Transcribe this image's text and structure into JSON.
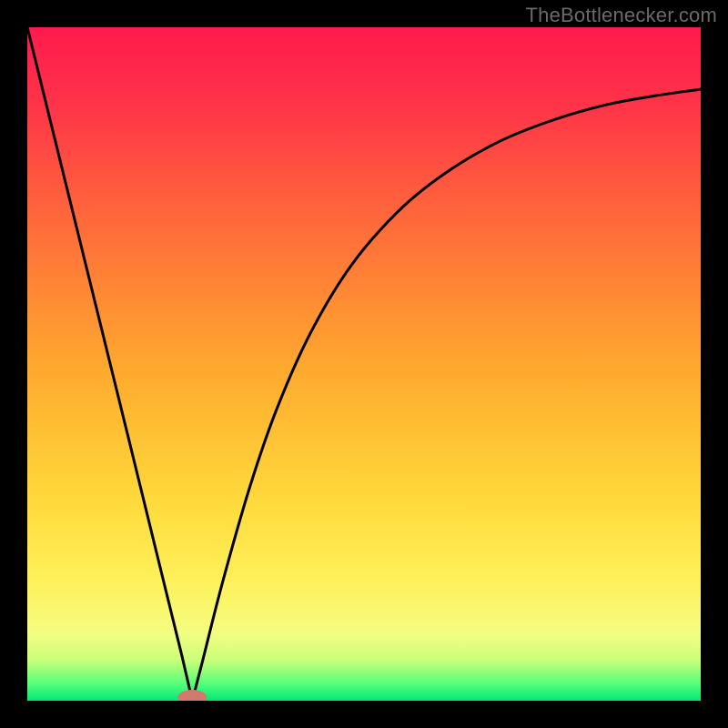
{
  "watermark": "TheBottlenecker.com",
  "gradient": {
    "stops": [
      {
        "offset": 0.0,
        "color": "#ff1a4d"
      },
      {
        "offset": 0.12,
        "color": "#ff3548"
      },
      {
        "offset": 0.3,
        "color": "#ff6d3a"
      },
      {
        "offset": 0.5,
        "color": "#ffa72e"
      },
      {
        "offset": 0.7,
        "color": "#ffd93a"
      },
      {
        "offset": 0.82,
        "color": "#fef05a"
      },
      {
        "offset": 0.9,
        "color": "#f4fd80"
      },
      {
        "offset": 0.94,
        "color": "#c9ff7a"
      },
      {
        "offset": 0.975,
        "color": "#55ff7a"
      },
      {
        "offset": 1.0,
        "color": "#00e876"
      }
    ]
  },
  "marker": {
    "x": 0.245,
    "rx": 16,
    "ry": 8,
    "fill": "#d47a6d"
  },
  "chart_data": {
    "type": "line",
    "title": "",
    "xlabel": "",
    "ylabel": "",
    "xlim": [
      0,
      1
    ],
    "ylim": [
      0,
      1
    ],
    "comment": "x and y are normalized to the plot area; y=1 is the top edge, y=0 is the bottom. Data traced from the rendered curve — a sharp V reaching the bottom near x≈0.245, then rising with diminishing slope toward the top-right.",
    "series": [
      {
        "name": "bottleneck-curve",
        "x": [
          0.0,
          0.05,
          0.1,
          0.15,
          0.2,
          0.23,
          0.245,
          0.26,
          0.29,
          0.33,
          0.37,
          0.42,
          0.48,
          0.55,
          0.62,
          0.7,
          0.78,
          0.86,
          0.93,
          1.0
        ],
        "y": [
          1.0,
          0.797,
          0.594,
          0.391,
          0.187,
          0.065,
          0.0,
          0.058,
          0.176,
          0.316,
          0.432,
          0.545,
          0.645,
          0.726,
          0.783,
          0.83,
          0.862,
          0.885,
          0.898,
          0.908
        ]
      }
    ],
    "marker_point": {
      "x": 0.245,
      "y": 0.0
    },
    "grid": false,
    "legend": false
  }
}
